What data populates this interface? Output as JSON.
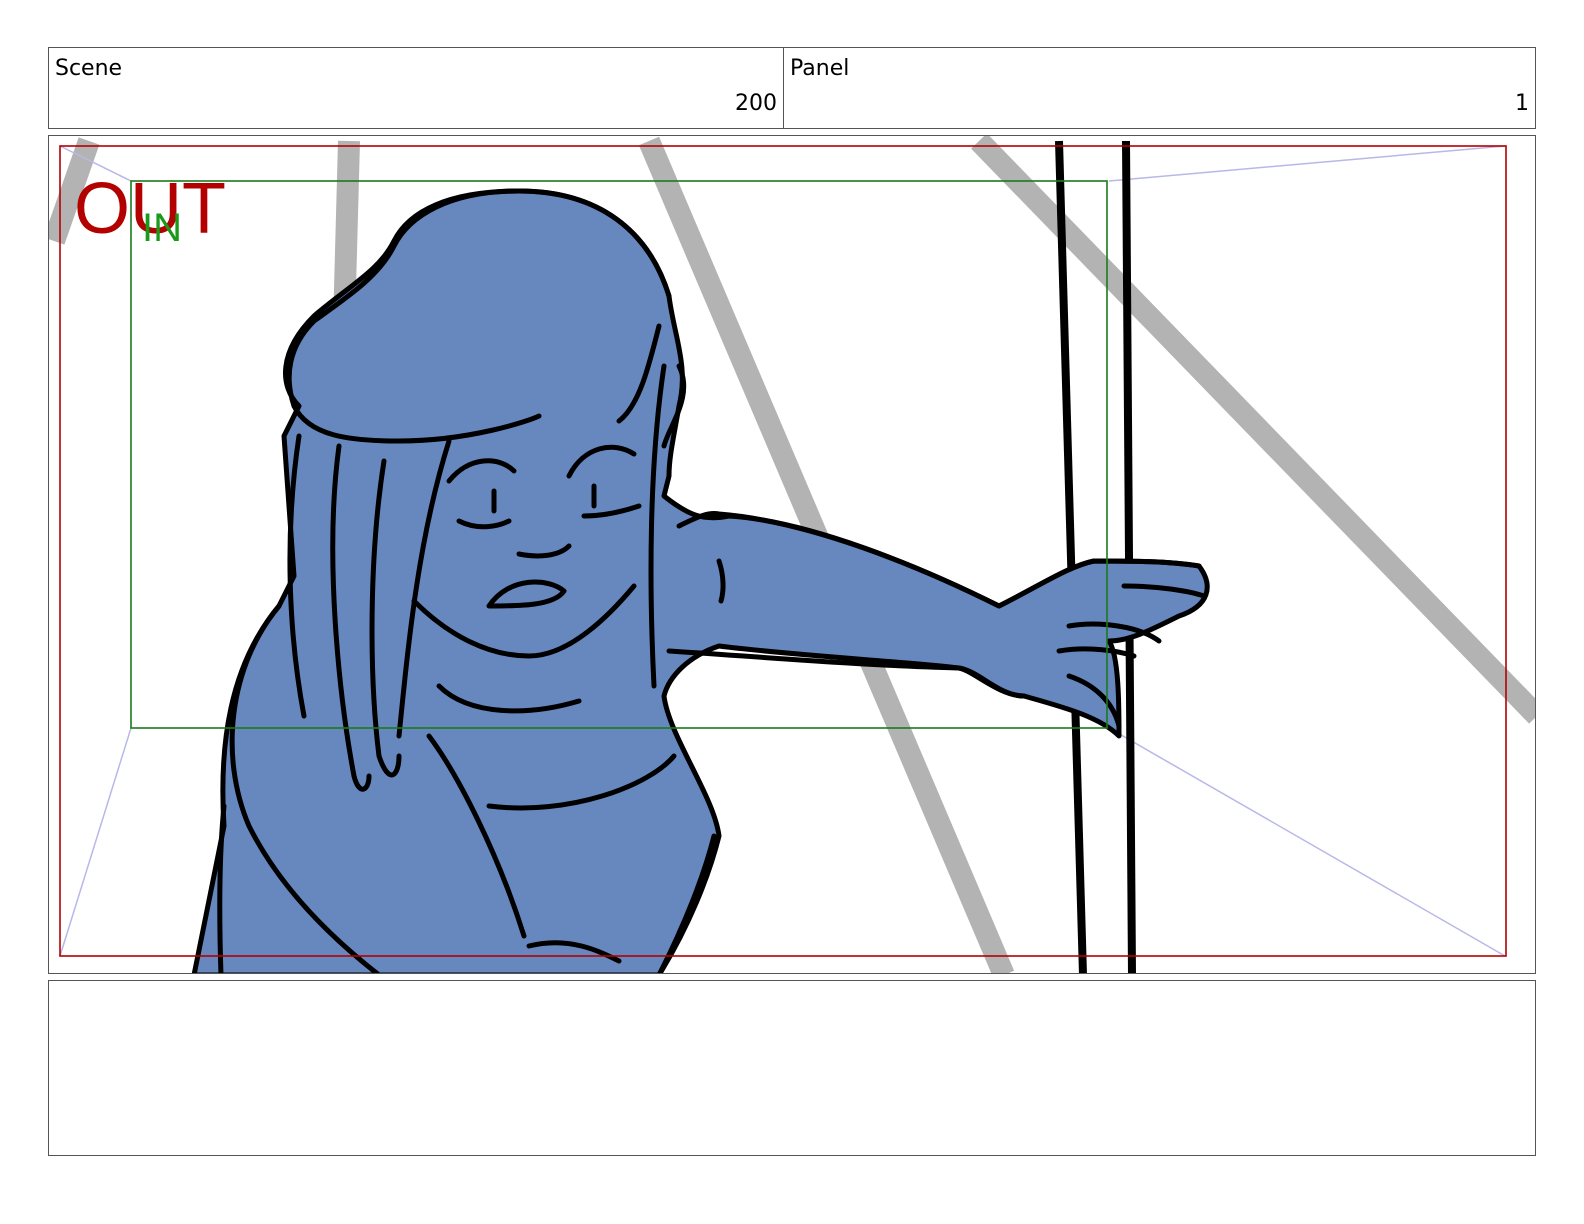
{
  "header": {
    "scene_label": "Scene",
    "scene_value": "200",
    "panel_label": "Panel",
    "panel_value": "1"
  },
  "camera": {
    "out_label": "OUT",
    "in_label": "IN",
    "out_color": "#b30000",
    "in_color": "#1a9a1a"
  },
  "colors": {
    "character_fill": "#6688bf",
    "line_art": "#000000",
    "background_strokes": "#b3b3b3",
    "frame_out": "#b30000",
    "frame_in": "#1a7a1a",
    "guide_lines": "#b8b8e8"
  },
  "notes": {
    "text": ""
  }
}
